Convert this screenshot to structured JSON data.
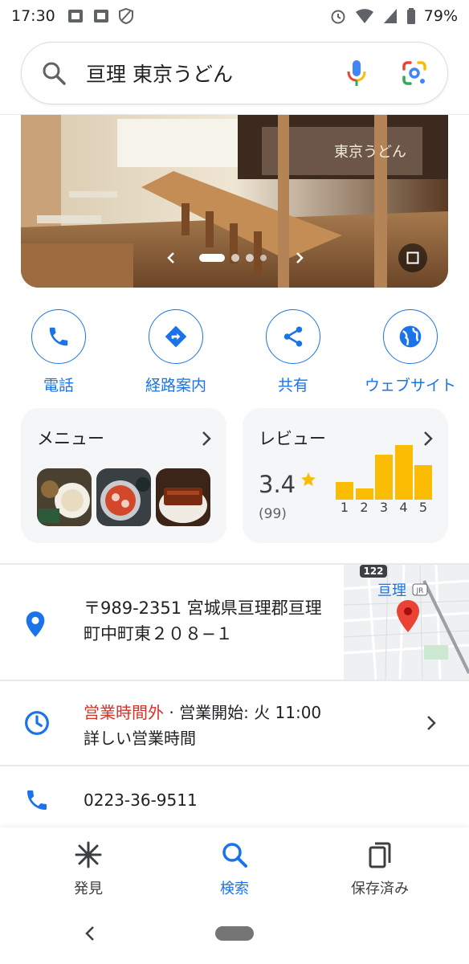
{
  "status": {
    "time": "17:30",
    "battery": "79%"
  },
  "search": {
    "query": "亘理 東京うどん"
  },
  "photo": {
    "sign": "東京うどん",
    "pager_total": 4,
    "pager_active": 1
  },
  "actions": [
    {
      "label": "電話",
      "icon": "phone-icon"
    },
    {
      "label": "経路案内",
      "icon": "directions-icon"
    },
    {
      "label": "共有",
      "icon": "share-icon"
    },
    {
      "label": "ウェブサイト",
      "icon": "globe-icon"
    }
  ],
  "menu_card": {
    "title": "メニュー"
  },
  "review_card": {
    "title": "レビュー",
    "rating": "3.4",
    "count": "(99)",
    "distribution": [
      {
        "label": "1",
        "value": 0.33
      },
      {
        "label": "2",
        "value": 0.2
      },
      {
        "label": "3",
        "value": 0.82
      },
      {
        "label": "4",
        "value": 1.0
      },
      {
        "label": "5",
        "value": 0.63
      }
    ]
  },
  "address": {
    "text": "〒989-2351 宮城県亘理郡亘理町中町東２０８−１"
  },
  "map": {
    "route_number": "122",
    "place_label": "亘理",
    "rail_label": "JR"
  },
  "hours": {
    "status": "営業時間外",
    "next": " · 営業開始: 火 11:00",
    "detail": "詳しい営業時間"
  },
  "phone": {
    "number": "0223-36-9511"
  },
  "bottom_nav": [
    {
      "label": "発見",
      "icon": "discover-icon",
      "active": false
    },
    {
      "label": "検索",
      "icon": "search-icon",
      "active": true
    },
    {
      "label": "保存済み",
      "icon": "saved-icon",
      "active": false
    }
  ],
  "colors": {
    "accent": "#1a73e8",
    "star": "#fbbc04",
    "closed": "#d93025"
  }
}
